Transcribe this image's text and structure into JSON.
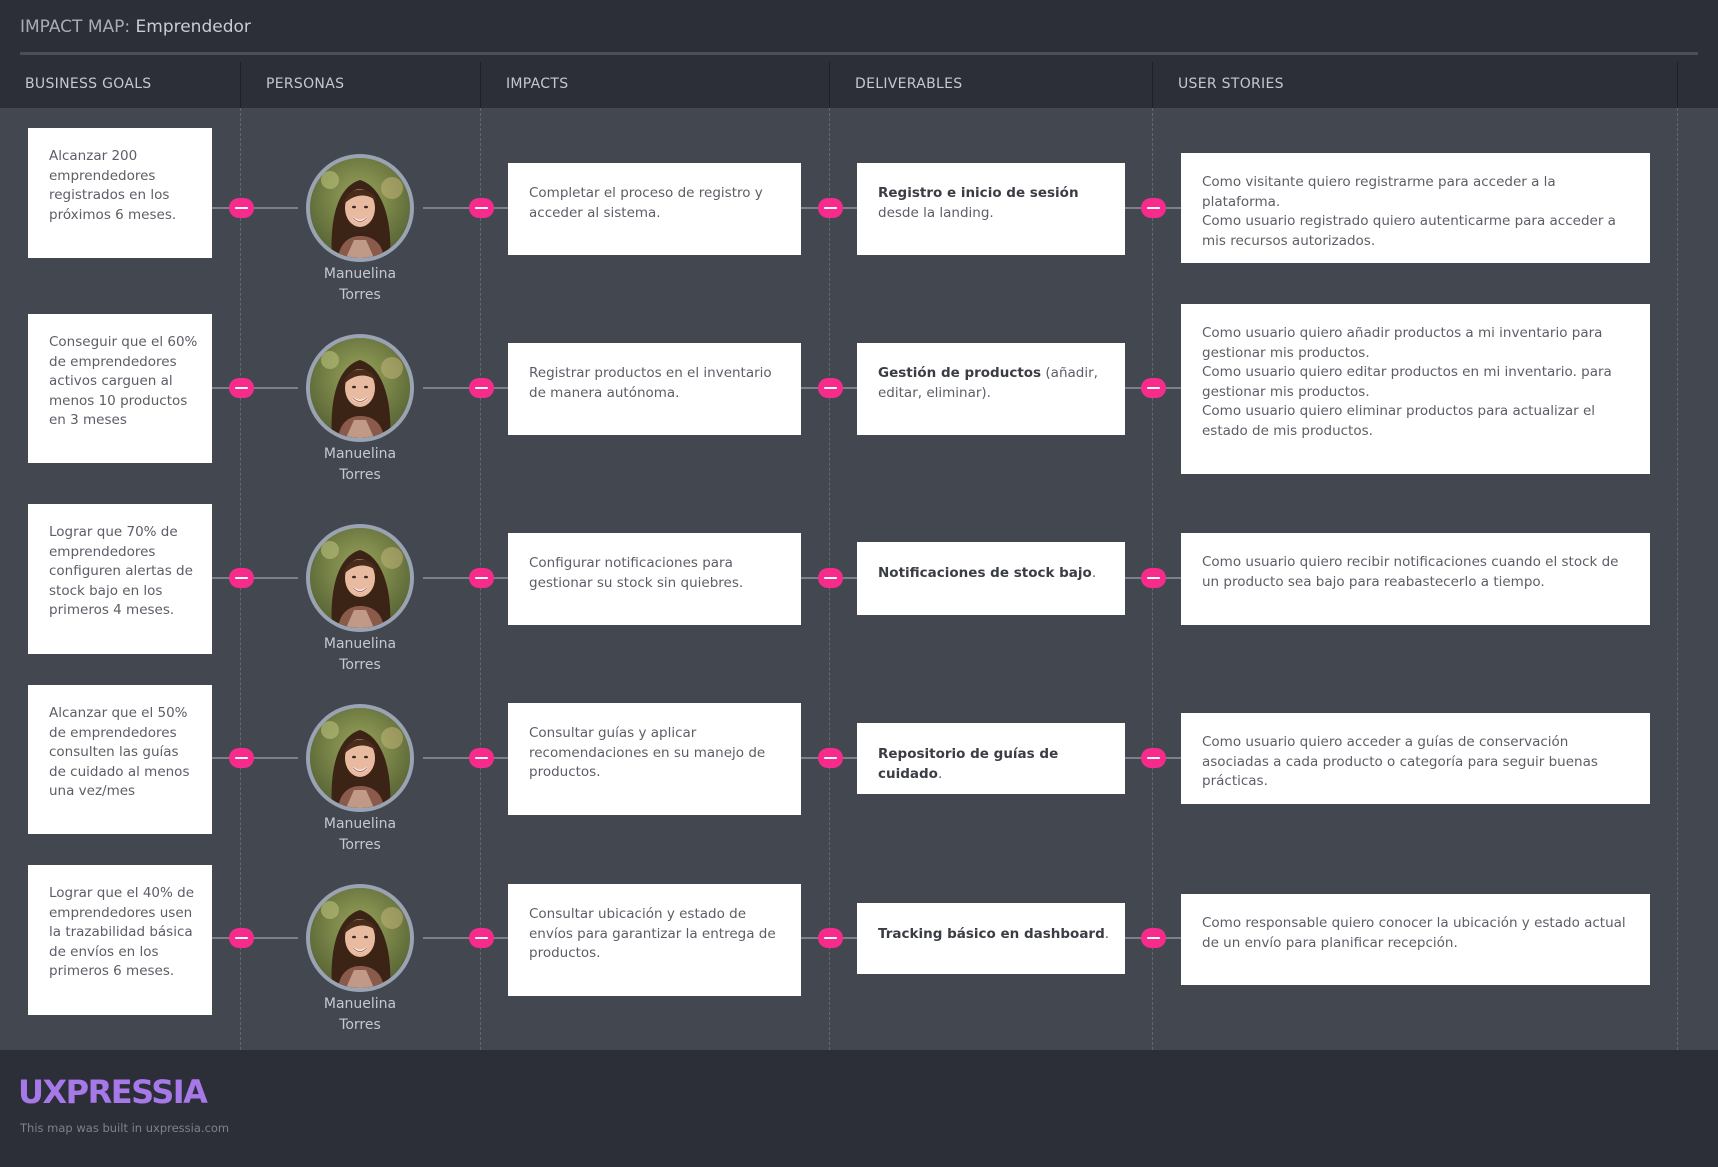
{
  "header": {
    "prefix": "IMPACT MAP: ",
    "name": "Emprendedor"
  },
  "columns": [
    "BUSINESS GOALS",
    "PERSONAS",
    "IMPACTS",
    "DELIVERABLES",
    "USER STORIES"
  ],
  "persona_name": "Manuelina Torres",
  "rows": [
    {
      "goal": "Alcanzar 200 emprendedores registrados en los próximos 6 meses.",
      "persona": [
        "Manuelina",
        "Torres"
      ],
      "impact": "Completar el proceso de registro y acceder al sistema.",
      "deliverable_bold": "Registro e inicio de sesión",
      "deliverable_rest": " desde la landing.",
      "stories": [
        "Como visitante quiero registrarme para acceder a la plataforma.",
        "Como usuario registrado quiero autenticarme para acceder a mis recursos autorizados."
      ]
    },
    {
      "goal": "Conseguir que el 60% de emprendedores activos carguen al menos 10 productos en 3 meses",
      "persona": [
        "Manuelina",
        "Torres"
      ],
      "impact": "Registrar productos en el inventario de manera autónoma.",
      "deliverable_bold": "Gestión de productos",
      "deliverable_rest": " (añadir, editar, eliminar).",
      "stories": [
        "Como usuario quiero añadir productos a mi inventario para gestionar mis productos.",
        "Como usuario quiero editar productos en mi inventario. para gestionar mis productos.",
        "Como usuario quiero eliminar productos para actualizar el estado de mis productos."
      ]
    },
    {
      "goal": "Lograr que 70% de emprendedores configuren alertas de stock bajo en los primeros 4 meses.",
      "persona": [
        "Manuelina",
        "Torres"
      ],
      "impact": "Configurar notificaciones para gestionar su stock sin quiebres.",
      "deliverable_bold": "Notificaciones de stock bajo",
      "deliverable_rest": ".",
      "stories": [
        "Como usuario quiero recibir notificaciones cuando el stock de un producto sea bajo para reabastecerlo a tiempo."
      ]
    },
    {
      "goal": "Alcanzar que el 50% de emprendedores consulten las guías de cuidado al menos una vez/mes",
      "persona": [
        "Manuelina",
        "Torres"
      ],
      "impact": "Consultar guías y aplicar recomendaciones en su manejo de productos.",
      "deliverable_bold": "Repositorio de guías de cuidado",
      "deliverable_rest": ".",
      "stories": [
        "Como usuario quiero acceder a guías de conservación asociadas a cada producto o categoría para seguir buenas prácticas."
      ]
    },
    {
      "goal": "Lograr que el 40% de emprendedores usen la trazabilidad básica de envíos en los primeros 6 meses.",
      "persona": [
        "Manuelina",
        "Torres"
      ],
      "impact": "Consultar ubicación y estado de envíos para garantizar la entrega de productos.",
      "deliverable_bold": "Tracking básico en dashboard",
      "deliverable_rest": ".",
      "stories": [
        "Como responsable quiero conocer la ubicación y estado actual de un envío para planificar recepción."
      ]
    }
  ],
  "footer": {
    "logo": "UXPRESSIA",
    "note": "This map was built in uxpressia.com"
  },
  "colors": {
    "connector": "#f72b8c",
    "logo": "#a678e8",
    "board": "#434750",
    "header": "#2c2f38"
  }
}
